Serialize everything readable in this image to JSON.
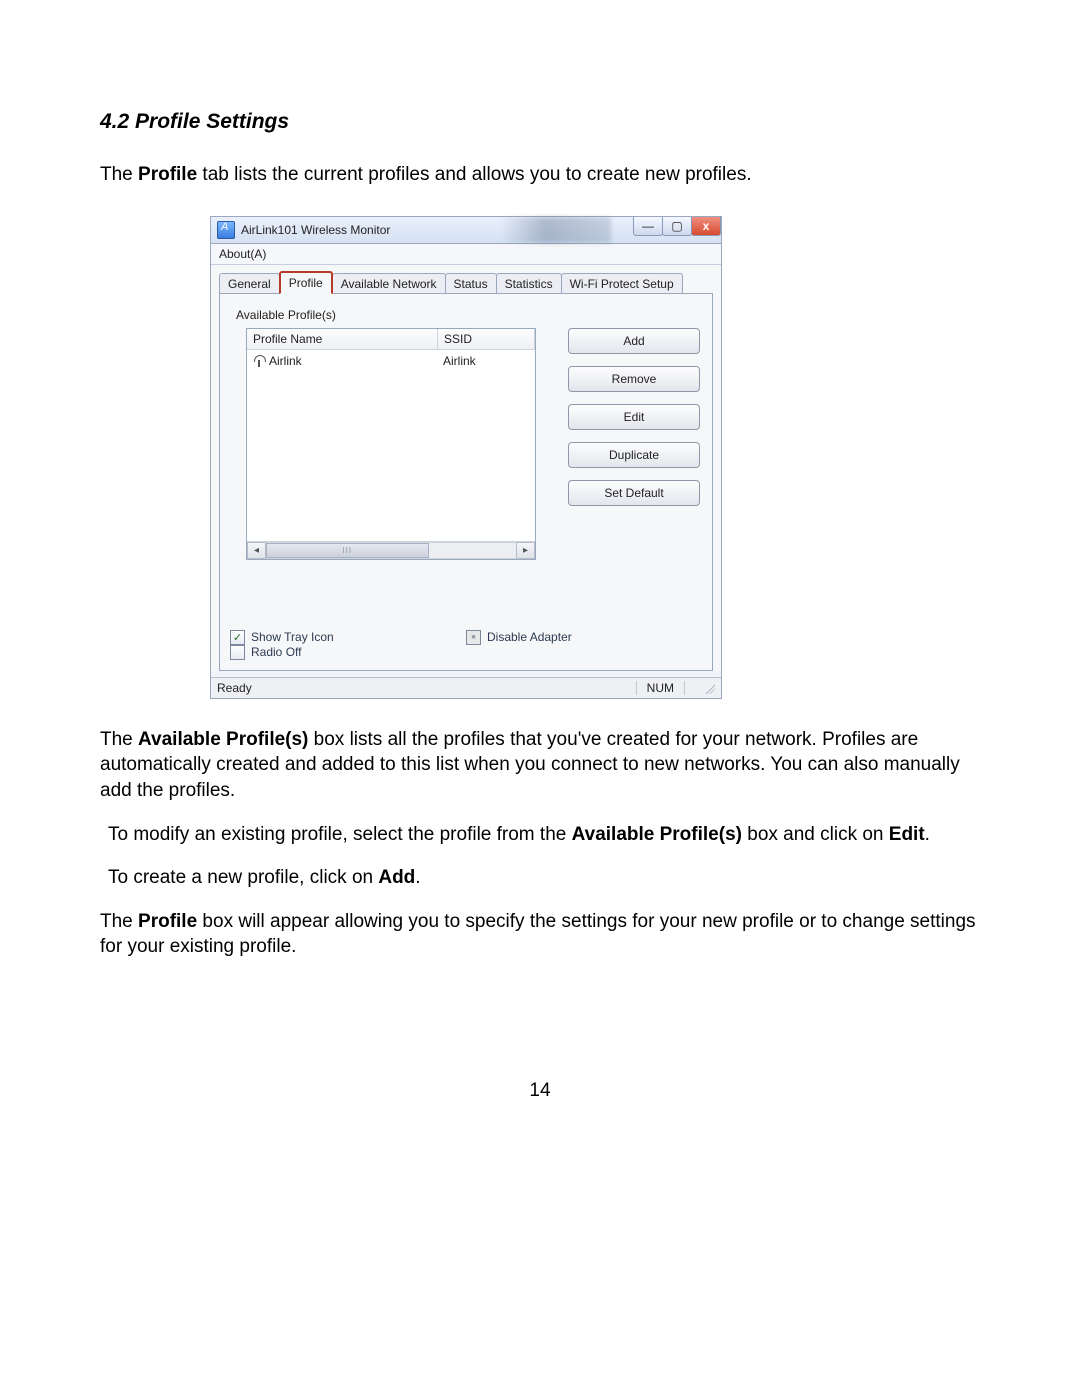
{
  "doc": {
    "section_title": "4.2 Profile Settings",
    "intro_pre": "The ",
    "intro_bold": "Profile",
    "intro_post": " tab lists the current profiles and allows you to create new profiles.",
    "p2_pre": "The ",
    "p2_b1": "Available Profile(s)",
    "p2_post": " box lists all the profiles that you've created for your network. Profiles are automatically created and added to this list when you connect to new networks. You can also manually add the profiles.",
    "p3_a": "To modify an existing profile, select the profile from the ",
    "p3_b1": "Available Profile(s)",
    "p3_b": " box and click on ",
    "p3_b2": "Edit",
    "p3_c": ".",
    "p4_a": "To create a new profile, click on ",
    "p4_b1": "Add",
    "p4_b": ".",
    "p5_a": "The ",
    "p5_b1": "Profile",
    "p5_b": " box will appear allowing you to specify the settings for your new profile or to change settings for your existing profile.",
    "page_number": "14"
  },
  "window": {
    "title": "AirLink101 Wireless Monitor",
    "menu": {
      "about": "About(A)"
    },
    "tabs": {
      "general": "General",
      "profile": "Profile",
      "available_network": "Available Network",
      "status": "Status",
      "statistics": "Statistics",
      "wps": "Wi-Fi Protect Setup"
    },
    "profiles": {
      "label": "Available Profile(s)",
      "columns": {
        "name": "Profile Name",
        "ssid": "SSID"
      },
      "rows": [
        {
          "name": "Airlink",
          "ssid": "Airlink"
        }
      ]
    },
    "buttons": {
      "add": "Add",
      "remove": "Remove",
      "edit": "Edit",
      "duplicate": "Duplicate",
      "set_default": "Set Default"
    },
    "options": {
      "show_tray_icon": "Show Tray Icon",
      "disable_adapter": "Disable Adapter",
      "radio_off": "Radio Off"
    },
    "statusbar": {
      "ready": "Ready",
      "num": "NUM"
    },
    "scroll_thumb": "III"
  }
}
